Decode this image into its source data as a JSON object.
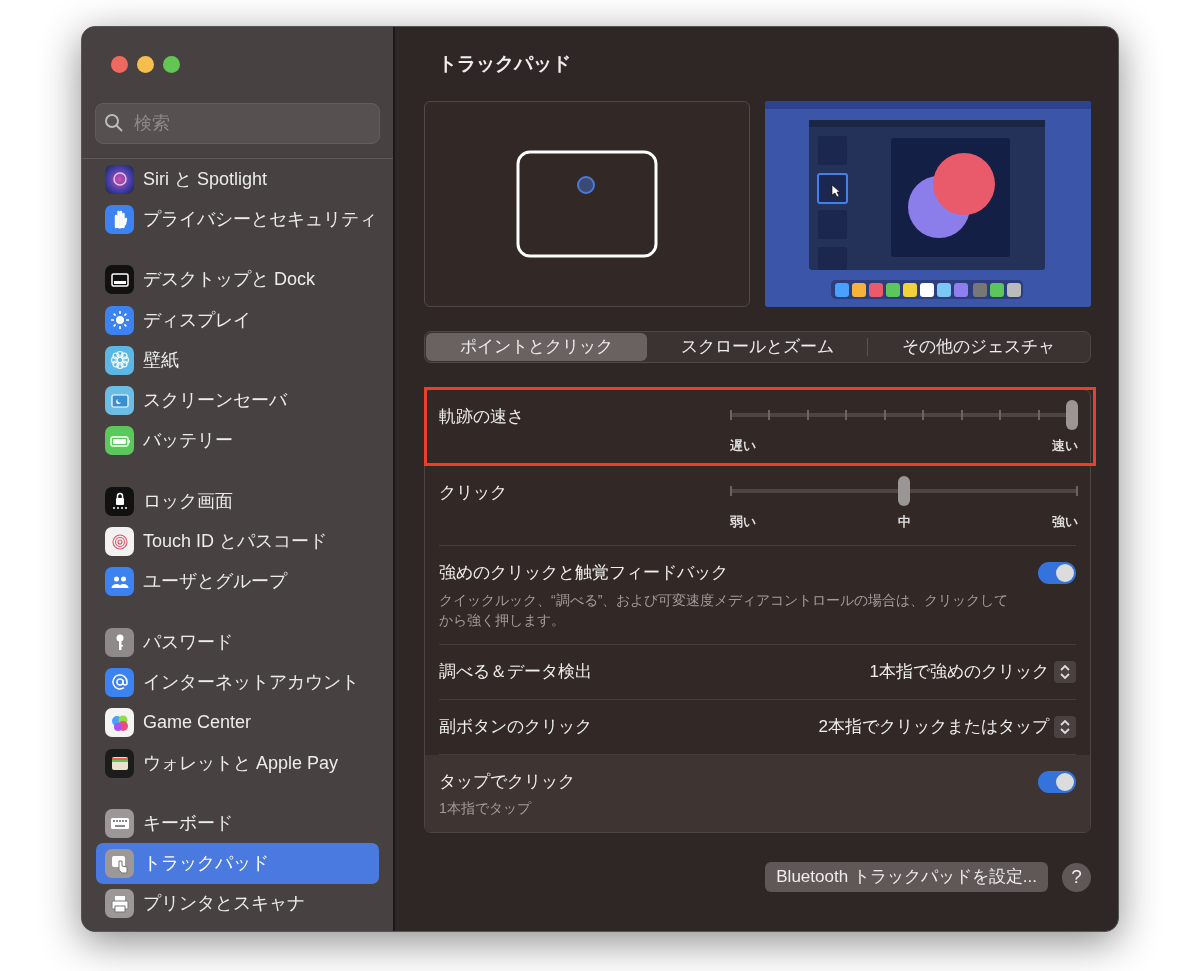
{
  "window": {
    "title": "トラックパッド"
  },
  "search": {
    "placeholder": "検索"
  },
  "sidebar": {
    "groups": [
      {
        "items": [
          {
            "label": "Siri と Spotlight",
            "selected": false
          },
          {
            "label": "プライバシーとセキュリティ",
            "selected": false
          }
        ]
      },
      {
        "items": [
          {
            "label": "デスクトップと Dock",
            "selected": false
          },
          {
            "label": "ディスプレイ",
            "selected": false
          },
          {
            "label": "壁紙",
            "selected": false
          },
          {
            "label": "スクリーンセーバ",
            "selected": false
          },
          {
            "label": "バッテリー",
            "selected": false
          }
        ]
      },
      {
        "items": [
          {
            "label": "ロック画面",
            "selected": false
          },
          {
            "label": "Touch ID とパスコード",
            "selected": false
          },
          {
            "label": "ユーザとグループ",
            "selected": false
          }
        ]
      },
      {
        "items": [
          {
            "label": "パスワード",
            "selected": false
          },
          {
            "label": "インターネットアカウント",
            "selected": false
          },
          {
            "label": "Game Center",
            "selected": false
          },
          {
            "label": "ウォレットと Apple Pay",
            "selected": false
          }
        ]
      },
      {
        "items": [
          {
            "label": "キーボード",
            "selected": false
          },
          {
            "label": "トラックパッド",
            "selected": true
          },
          {
            "label": "プリンタとスキャナ",
            "selected": false
          }
        ]
      }
    ]
  },
  "tabs": [
    {
      "label": "ポイントとクリック",
      "selected": true
    },
    {
      "label": "スクロールとズーム",
      "selected": false
    },
    {
      "label": "その他のジェスチャ",
      "selected": false
    }
  ],
  "settings": [
    {
      "kind": "slider",
      "label": "軌跡の速さ",
      "level": 1,
      "labels": [
        "遅い",
        "速い"
      ],
      "highlighted": true
    },
    {
      "kind": "slider",
      "label": "クリック",
      "level": 0.5,
      "labels": [
        "弱い",
        "中",
        "強い"
      ],
      "highlighted": false
    },
    {
      "kind": "toggle",
      "label": "強めのクリックと触覚フィードバック",
      "description": "クイックルック、“調べる”、および可変速度メディアコントロールの場合は、クリックしてから強く押します。",
      "on": true,
      "hovered": false
    },
    {
      "kind": "popup",
      "label": "調べる＆データ検出",
      "value": "1本指で強めのクリック"
    },
    {
      "kind": "popup",
      "label": "副ボタンのクリック",
      "value": "2本指でクリックまたはタップ"
    },
    {
      "kind": "toggle",
      "label": "タップでクリック",
      "description": "1本指でタップ",
      "on": true,
      "hovered": true
    }
  ],
  "buttons": {
    "setup": "Bluetooth トラックパッドを設定...",
    "help": "?"
  }
}
